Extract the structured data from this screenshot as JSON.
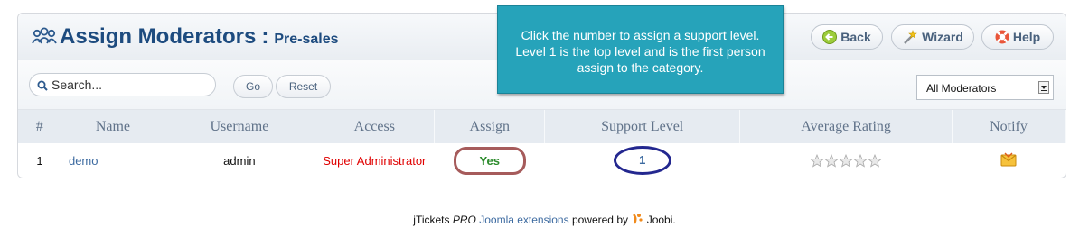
{
  "header": {
    "title": "Assign Moderators",
    "separator": ":",
    "subtitle": "Pre-sales",
    "title_icon": "users-icon",
    "buttons": [
      {
        "label": "Back",
        "icon": "back-arrow-icon"
      },
      {
        "label": "Wizard",
        "icon": "magic-wand-icon"
      },
      {
        "label": "Help",
        "icon": "lifebuoy-icon"
      }
    ]
  },
  "toolbar": {
    "search_placeholder": "Search...",
    "go_label": "Go",
    "reset_label": "Reset",
    "filter_value": "All Moderators"
  },
  "table": {
    "columns": [
      "#",
      "Name",
      "Username",
      "Access",
      "Assign",
      "Support Level",
      "Average Rating",
      "Notify"
    ],
    "rows": [
      {
        "num": "1",
        "name": "demo",
        "username": "admin",
        "access": "Super Administrator",
        "assign": "Yes",
        "support_level": "1",
        "rating_stars": 0,
        "rating_max": 5,
        "notify_icon": "envelope-notify-icon"
      }
    ]
  },
  "tooltip": {
    "line1": "Click the number to assign a support level.",
    "line2": "Level 1 is the top level and is the first person",
    "line3": "assign to the category."
  },
  "footer": {
    "product": "jTickets",
    "pro": "PRO",
    "link_text": "Joomla extensions",
    "powered_by": "powered by",
    "brand": "Joobi."
  },
  "colors": {
    "title": "#1d4b7f",
    "link": "#3c6aa0",
    "access_red": "#e00000",
    "assign_green": "#2a8a2a",
    "tooltip_bg": "#26a3ba",
    "yes_circle": "#a65b5b",
    "level_circle": "#23278f"
  }
}
